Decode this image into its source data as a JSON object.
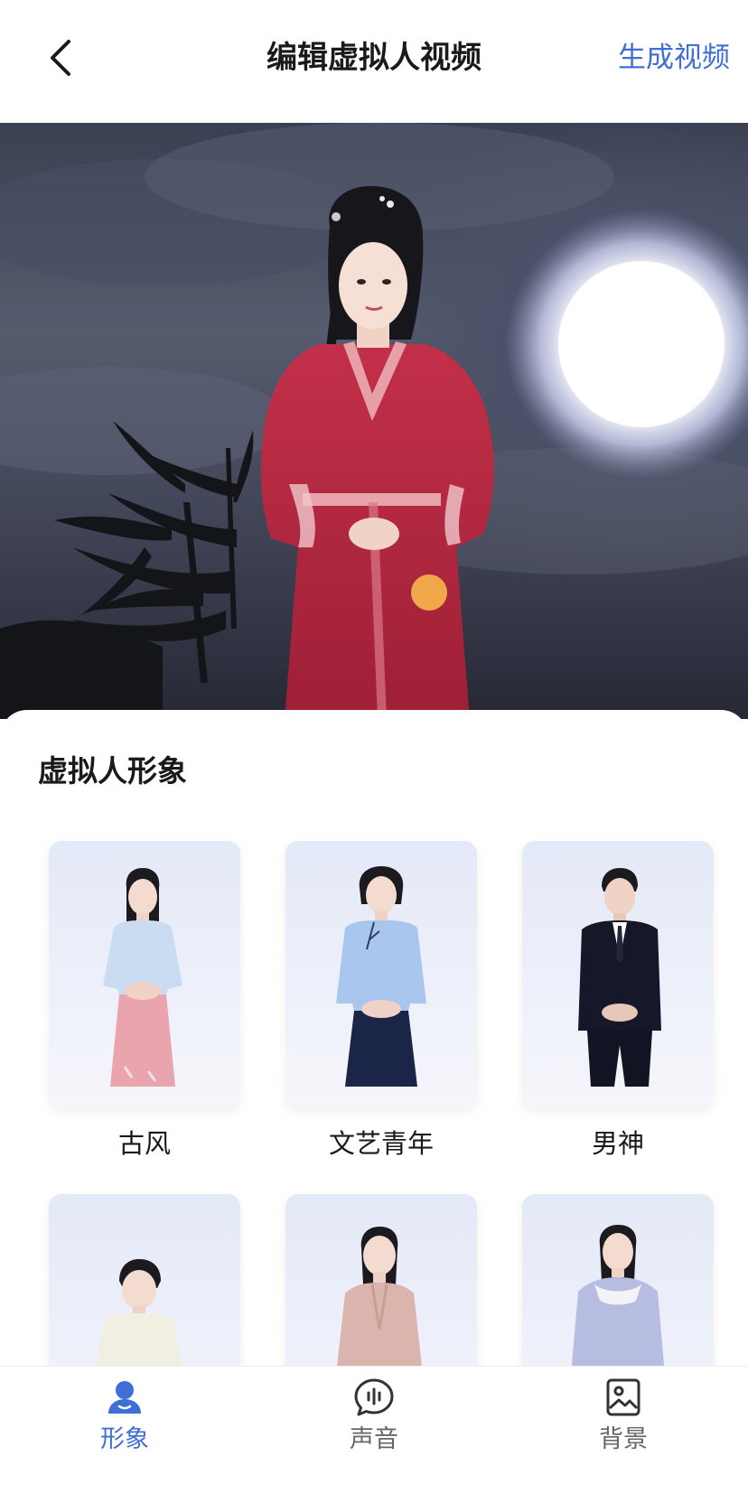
{
  "header": {
    "title": "编辑虚拟人视频",
    "action_label": "生成视频"
  },
  "sheet": {
    "title": "虚拟人形象",
    "avatars": [
      {
        "label": "古风"
      },
      {
        "label": "文艺青年"
      },
      {
        "label": "男神"
      },
      {
        "label": ""
      },
      {
        "label": ""
      },
      {
        "label": ""
      }
    ]
  },
  "tabs": [
    {
      "label": "形象",
      "icon": "person-icon",
      "active": true
    },
    {
      "label": "声音",
      "icon": "voice-chat-icon",
      "active": false
    },
    {
      "label": "背景",
      "icon": "image-icon",
      "active": false
    }
  ],
  "colors": {
    "accent": "#3f6ed4",
    "dress": "#b5263c"
  }
}
